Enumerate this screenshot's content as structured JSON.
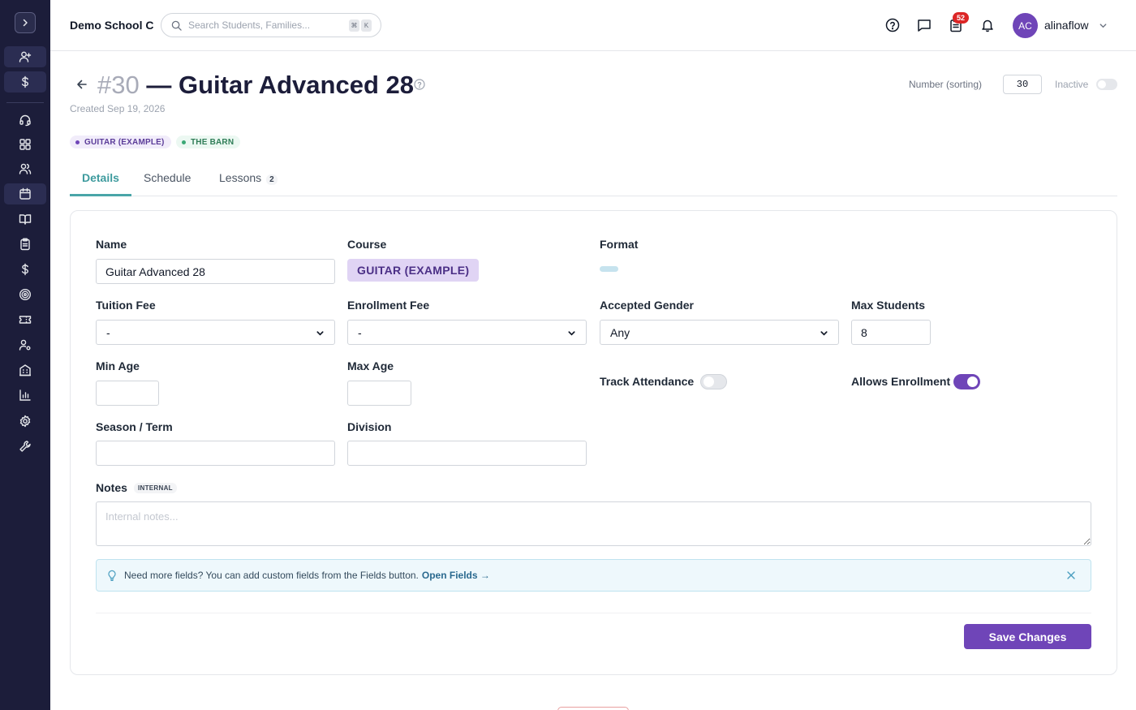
{
  "topbar": {
    "school_name": "Demo School C",
    "search_placeholder": "Search Students, Families...",
    "shortcut": [
      "⌘",
      "K"
    ],
    "notifications_count": "52",
    "user_initials": "AC",
    "username": "alinaflow"
  },
  "header": {
    "number": "#30",
    "title": "— Guitar Advanced 28",
    "created": "Created Sep 19, 2026",
    "sort_label": "Number (sorting)",
    "sort_value": "30",
    "inactive_label": "Inactive",
    "tags": [
      "GUITAR (EXAMPLE)",
      "THE BARN"
    ]
  },
  "tabs": [
    {
      "label": "Details",
      "active": true
    },
    {
      "label": "Schedule"
    },
    {
      "label": "Lessons",
      "count": "2"
    }
  ],
  "form": {
    "name_label": "Name",
    "name_value": "Guitar Advanced 28",
    "course_label": "Course",
    "course_value": "GUITAR (EXAMPLE)",
    "format_label": "Format",
    "tuition_label": "Tuition Fee",
    "tuition_value": "-",
    "enrollment_label": "Enrollment Fee",
    "enrollment_value": "-",
    "gender_label": "Accepted Gender",
    "gender_value": "Any",
    "max_students_label": "Max Students",
    "max_students_value": "8",
    "min_age_label": "Min Age",
    "max_age_label": "Max Age",
    "track_attendance_label": "Track Attendance",
    "track_attendance_on": false,
    "allows_enrollment_label": "Allows Enrollment",
    "allows_enrollment_on": true,
    "season_label": "Season / Term",
    "division_label": "Division",
    "notes_label": "Notes",
    "notes_chip": "INTERNAL",
    "notes_placeholder": "Internal notes...",
    "info_text": "Need more fields? You can add custom fields from the Fields button.",
    "info_link": "Open Fields →",
    "save_label": "Save Changes"
  },
  "colors": {
    "sidebar": "#1c1d3a",
    "accent": "#6f45b8",
    "tab_active": "#3e9b9e",
    "badge": "#dc2626"
  }
}
